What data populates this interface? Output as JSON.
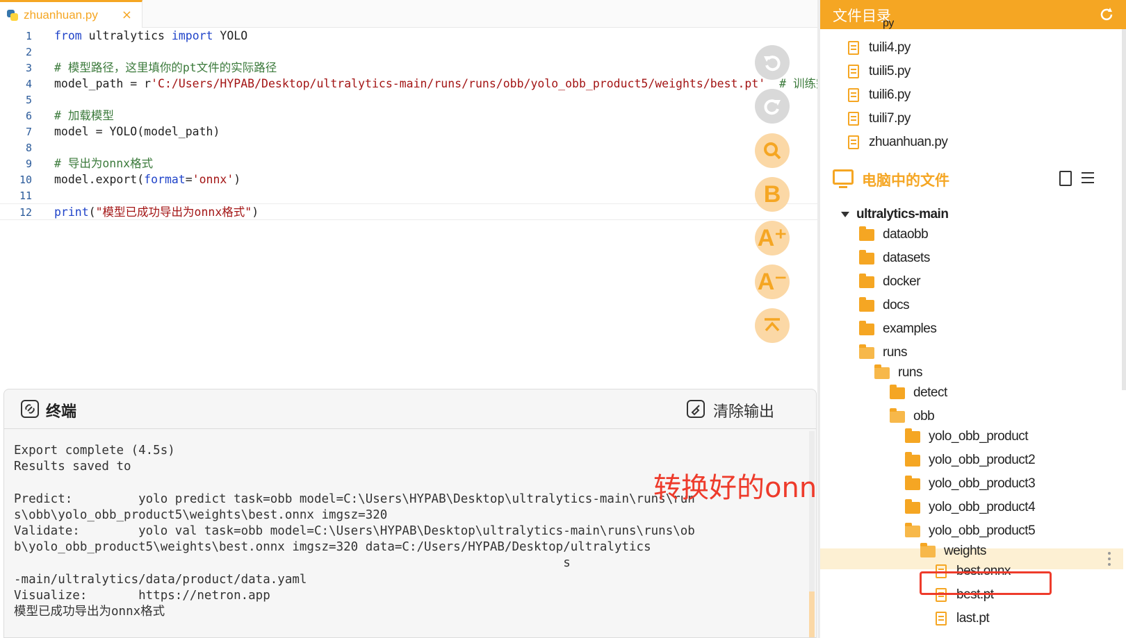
{
  "editor": {
    "tab": {
      "filename": "zhuanhuan.py",
      "close": "×"
    },
    "lines": [
      {
        "n": "1",
        "parts": [
          {
            "t": "from",
            "c": "kw"
          },
          {
            "t": " ultralytics ",
            "c": ""
          },
          {
            "t": "import",
            "c": "kw"
          },
          {
            "t": " YOLO",
            "c": ""
          }
        ]
      },
      {
        "n": "2",
        "parts": []
      },
      {
        "n": "3",
        "parts": [
          {
            "t": "# 模型路径，这里填你的pt文件的实际路径",
            "c": "cm"
          }
        ]
      },
      {
        "n": "4",
        "parts": [
          {
            "t": "model_path = r",
            "c": ""
          },
          {
            "t": "'C:/Users/HYPAB/Desktop/ultralytics-main/runs/runs/obb/yolo_obb_product5/weights/best.pt'",
            "c": "str"
          },
          {
            "t": "  # 训练完成",
            "c": "cm"
          }
        ]
      },
      {
        "n": "5",
        "parts": []
      },
      {
        "n": "6",
        "parts": [
          {
            "t": "# 加载模型",
            "c": "cm"
          }
        ]
      },
      {
        "n": "7",
        "parts": [
          {
            "t": "model = YOLO(model_path)",
            "c": ""
          }
        ]
      },
      {
        "n": "8",
        "parts": []
      },
      {
        "n": "9",
        "parts": [
          {
            "t": "# 导出为onnx格式",
            "c": "cm"
          }
        ]
      },
      {
        "n": "10",
        "parts": [
          {
            "t": "model.export(",
            "c": ""
          },
          {
            "t": "format",
            "c": "kw"
          },
          {
            "t": "=",
            "c": ""
          },
          {
            "t": "'onnx'",
            "c": "str"
          },
          {
            "t": ")",
            "c": ""
          }
        ]
      },
      {
        "n": "11",
        "parts": []
      },
      {
        "n": "12",
        "parts": [
          {
            "t": "print",
            "c": "fn"
          },
          {
            "t": "(",
            "c": ""
          },
          {
            "t": "\"模型已成功导出为onnx格式\"",
            "c": "str"
          },
          {
            "t": ")",
            "c": ""
          }
        ]
      }
    ],
    "tools": [
      {
        "name": "undo-icon",
        "style": "gray"
      },
      {
        "name": "redo-icon",
        "style": "gray"
      },
      {
        "name": "search-icon",
        "style": "orange"
      },
      {
        "name": "bold-icon",
        "style": "orange",
        "glyph": "B"
      },
      {
        "name": "font-increase-icon",
        "style": "orange",
        "glyph": "A⁺"
      },
      {
        "name": "font-decrease-icon",
        "style": "orange",
        "glyph": "A⁻"
      },
      {
        "name": "scroll-top-icon",
        "style": "orange"
      }
    ]
  },
  "terminal": {
    "title": "终端",
    "clear_label": "清除输出",
    "lines": [
      "Export complete (4.5s)",
      "Results saved to",
      "",
      "Predict:         yolo predict task=obb model=C:\\Users\\HYPAB\\Desktop\\ultralytics-main\\runs\\run",
      "s\\obb\\yolo_obb_product5\\weights\\best.onnx imgsz=320",
      "Validate:        yolo val task=obb model=C:\\Users\\HYPAB\\Desktop\\ultralytics-main\\runs\\runs\\ob",
      "b\\yolo_obb_product5\\weights\\best.onnx imgsz=320 data=C:/Users/HYPAB/Desktop/ultralytics",
      "                                                                           s",
      "-main/ultralytics/data/product/data.yaml",
      "Visualize:       https://netron.app",
      "模型已成功导出为onnx格式"
    ]
  },
  "annotation": {
    "text": "转换好的onnx模型"
  },
  "sidebar": {
    "title": "文件目录",
    "partial_top": "py",
    "top_files": [
      "tuili4.py",
      "tuili5.py",
      "tuili6.py",
      "tuili7.py",
      "zhuanhuan.py"
    ],
    "section_label": "电脑中的文件",
    "root": "ultralytics-main",
    "tree": [
      {
        "label": "dataobb",
        "type": "folder",
        "indent": 1
      },
      {
        "label": "datasets",
        "type": "folder",
        "indent": 1
      },
      {
        "label": "docker",
        "type": "folder",
        "indent": 1
      },
      {
        "label": "docs",
        "type": "folder",
        "indent": 1
      },
      {
        "label": "examples",
        "type": "folder",
        "indent": 1
      },
      {
        "label": "runs",
        "type": "folder-open",
        "indent": 1
      },
      {
        "label": "runs",
        "type": "folder-open",
        "indent": 2
      },
      {
        "label": "detect",
        "type": "folder",
        "indent": 3
      },
      {
        "label": "obb",
        "type": "folder-open",
        "indent": 3
      },
      {
        "label": "yolo_obb_product",
        "type": "folder",
        "indent": 4
      },
      {
        "label": "yolo_obb_product2",
        "type": "folder",
        "indent": 4
      },
      {
        "label": "yolo_obb_product3",
        "type": "folder",
        "indent": 4
      },
      {
        "label": "yolo_obb_product4",
        "type": "folder",
        "indent": 4
      },
      {
        "label": "yolo_obb_product5",
        "type": "folder-open",
        "indent": 4
      },
      {
        "label": "weights",
        "type": "folder-open",
        "indent": 5
      },
      {
        "label": "best.onnx",
        "type": "file",
        "indent": 6
      },
      {
        "label": "best.pt",
        "type": "file",
        "indent": 6
      },
      {
        "label": "last.pt",
        "type": "file",
        "indent": 6
      }
    ]
  }
}
